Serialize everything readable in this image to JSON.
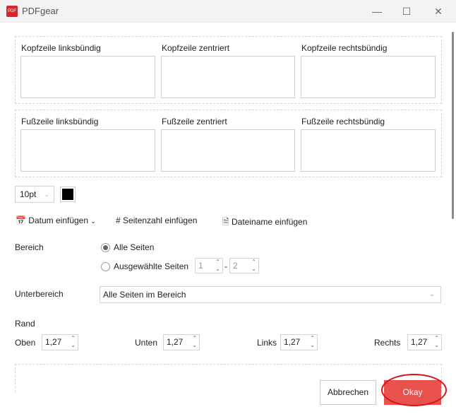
{
  "window": {
    "title": "PDFgear",
    "logo_text": "PDF"
  },
  "header": {
    "left": "Kopfzeile linksbündig",
    "center": "Kopfzeile zentriert",
    "right": "Kopfzeile rechtsbündig"
  },
  "footer": {
    "left": "Fußzeile linksbündig",
    "center": "Fußzeile zentriert",
    "right": "Fußzeile rechtsbündig"
  },
  "font_size": "10pt",
  "font_color": "#000000",
  "tools": {
    "date": "Datum einfügen",
    "page_number": "Seitenzahl einfügen",
    "filename": "Dateiname einfügen"
  },
  "range": {
    "label": "Bereich",
    "all": "Alle Seiten",
    "selected": "Ausgewählte Seiten",
    "from": "1",
    "sep": "-",
    "to": "2"
  },
  "subrange": {
    "label": "Unterbereich",
    "value": "Alle Seiten im Bereich"
  },
  "margin": {
    "label": "Rand",
    "top_label": "Oben",
    "top": "1,27",
    "bottom_label": "Unten",
    "bottom": "1,27",
    "left_label": "Links",
    "left": "1,27",
    "right_label": "Rechts",
    "right": "1,27"
  },
  "buttons": {
    "cancel": "Abbrechen",
    "ok": "Okay"
  },
  "accent": "#e9514c"
}
